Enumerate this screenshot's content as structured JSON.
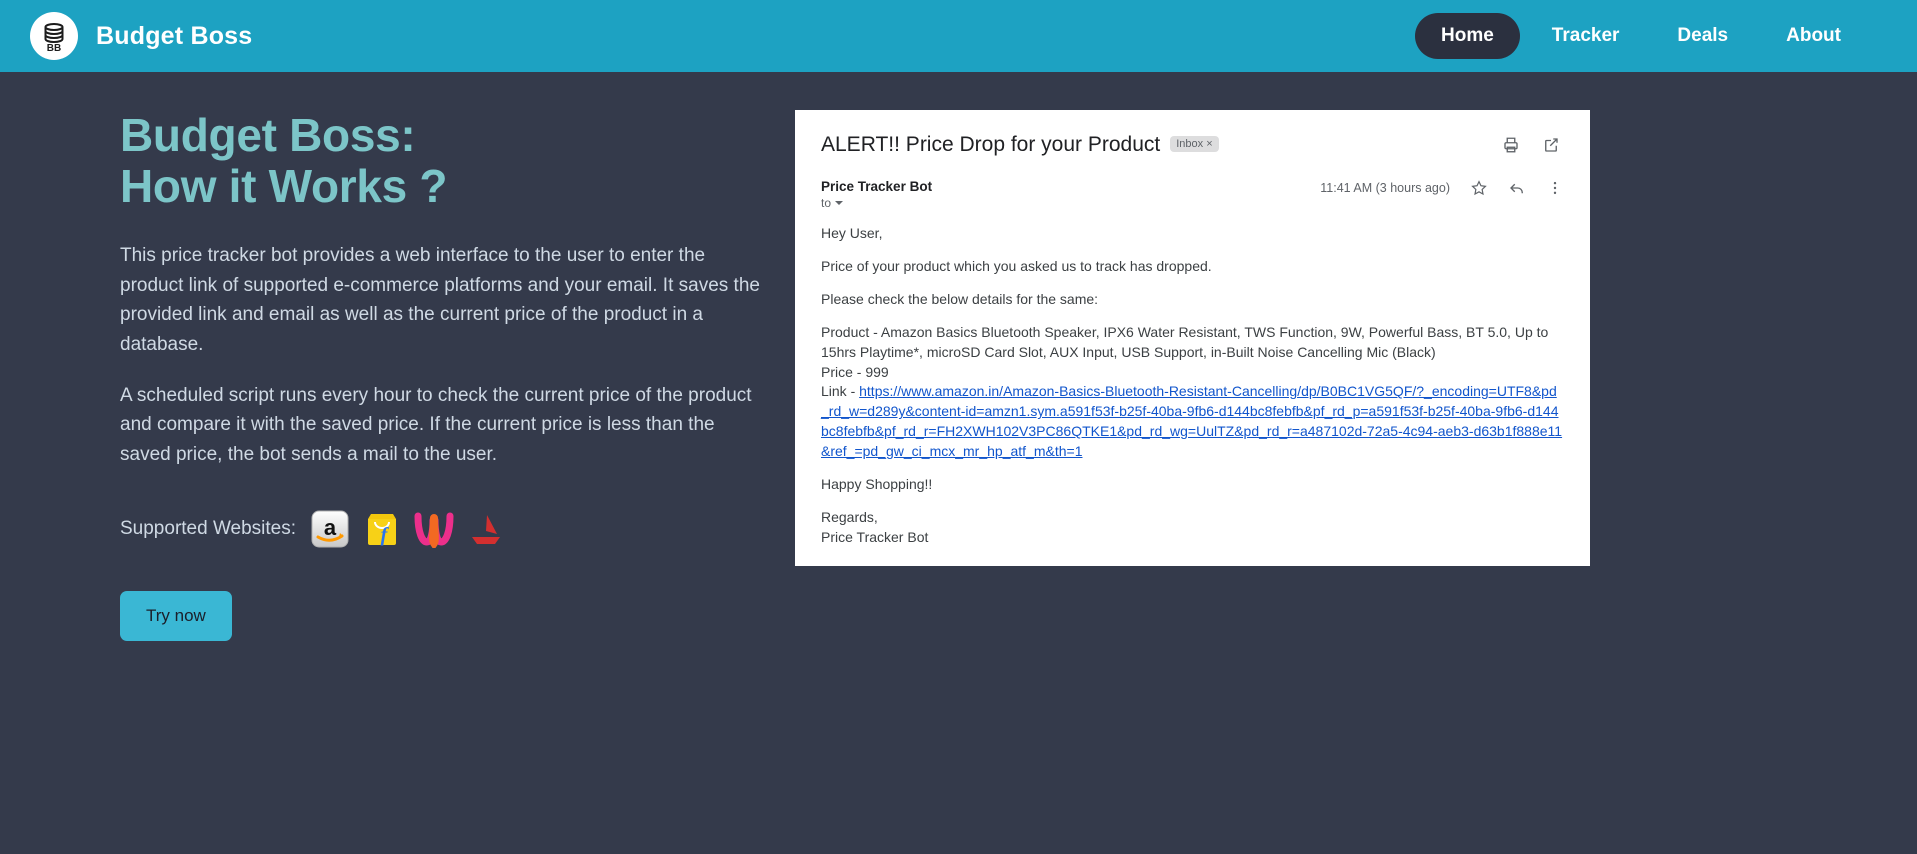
{
  "navbar": {
    "brand_title": "Budget Boss",
    "logo_initials": "BB",
    "accent_color": "#1da2c2",
    "active_pill_color": "#2b303f",
    "links": [
      {
        "label": "Home",
        "active": true
      },
      {
        "label": "Tracker",
        "active": false
      },
      {
        "label": "Deals",
        "active": false
      },
      {
        "label": "About",
        "active": false
      }
    ]
  },
  "hero": {
    "title_line1": "Budget Boss:",
    "title_line2": "How it Works ?",
    "title_color": "#7cc5c8",
    "paragraph1": "This price tracker bot provides a web interface to the user to enter the product link of supported e-commerce platforms and your email. It saves the provided link and email as well as the current price of the product in a database.",
    "paragraph2": "A scheduled script runs every hour to check the current price of the product and compare it with the saved price. If the current price is less than the saved price, the bot sends a mail to the user.",
    "supported_label": "Supported Websites:",
    "supported_sites": [
      {
        "name": "amazon-icon",
        "label": "Amazon"
      },
      {
        "name": "flipkart-icon",
        "label": "Flipkart"
      },
      {
        "name": "myntra-icon",
        "label": "Myntra"
      },
      {
        "name": "ajio-icon",
        "label": "Ajio"
      }
    ],
    "try_now_label": "Try now",
    "try_now_color": "#3ab7d4"
  },
  "email": {
    "subject": "ALERT!! Price Drop for your Product",
    "label_chip": "Inbox ×",
    "print_icon": "print-icon",
    "open_in_new_icon": "open-in-new-icon",
    "sender": "Price Tracker Bot",
    "to_label": "to",
    "timestamp": "11:41 AM (3 hours ago)",
    "star_icon": "star-icon",
    "reply_icon": "reply-icon",
    "more_icon": "more-vertical-icon",
    "greeting": "Hey User,",
    "line1": "Price of your product which you asked us to track has dropped.",
    "line2": "Please check the below details for the same:",
    "product_line": "Product - Amazon Basics Bluetooth Speaker, IPX6 Water Resistant, TWS Function, 9W, Powerful Bass, BT 5.0, Up to 15hrs Playtime*, microSD Card Slot, AUX Input, USB Support, in-Built Noise Cancelling Mic (Black)",
    "price_line": "Price - 999",
    "link_prefix": "Link - ",
    "link_url": "https://www.amazon.in/Amazon-Basics-Bluetooth-Resistant-Cancelling/dp/B0BC1VG5QF/?_encoding=UTF8&pd_rd_w=d289y&content-id=amzn1.sym.a591f53f-b25f-40ba-9fb6-d144bc8febfb&pf_rd_p=a591f53f-b25f-40ba-9fb6-d144bc8febfb&pf_rd_r=FH2XWH102V3PC86QTKE1&pd_rd_wg=UulTZ&pd_rd_r=a487102d-72a5-4c94-aeb3-d63b1f888e11&ref_=pd_gw_ci_mcx_mr_hp_atf_m&th=1",
    "closing": "Happy Shopping!!",
    "regards": "Regards,",
    "signature": "Price Tracker Bot",
    "link_color": "#1155cc"
  }
}
